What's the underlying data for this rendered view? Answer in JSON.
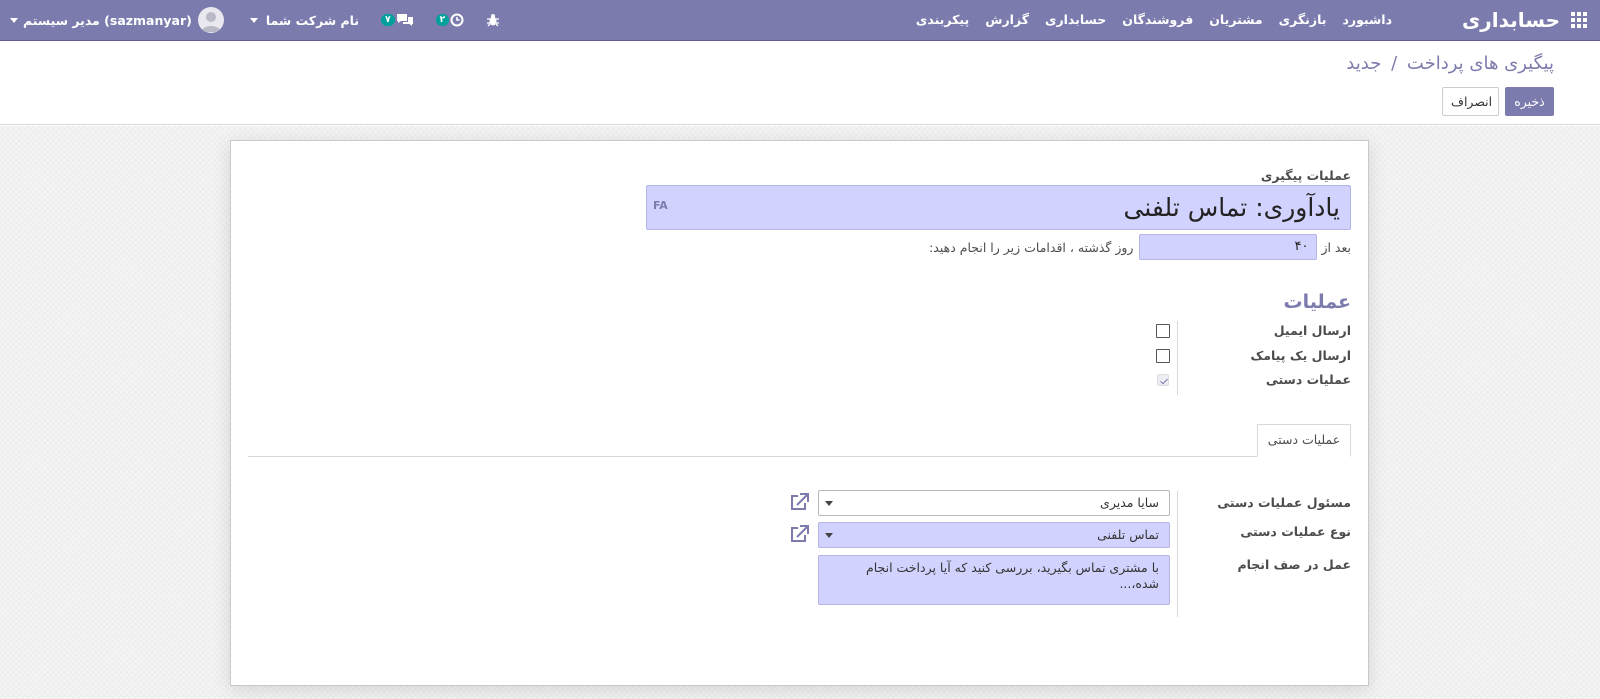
{
  "navbar": {
    "app_title": "حسابداری",
    "menu": [
      "داشبورد",
      "بازنگری",
      "مشتریان",
      "فروشندگان",
      "حسابداری",
      "گزارش",
      "پیکربندی"
    ],
    "user_label": "مدیر سیستم (sazmanyar)",
    "company_label": "نام شرکت شما",
    "messages_count": "۷",
    "activities_count": "۲"
  },
  "control_panel": {
    "breadcrumb_parent": "پیگیری های پرداخت",
    "breadcrumb_sep": "/",
    "breadcrumb_current": "جدید",
    "save_label": "ذخیره",
    "cancel_label": "انصراف"
  },
  "form": {
    "name_label": "عملیات پیگیری",
    "name_value": "یادآوری: تماس تلفنی",
    "lang_tag": "FA",
    "delay_prefix": "بعد از",
    "delay_value": "۴۰",
    "delay_suffix": "روز گذشته ، اقدامات زیر را انجام دهید:",
    "section_title": "عملیات",
    "options": [
      {
        "label": "ارسال ایمیل",
        "checked": false
      },
      {
        "label": "ارسال یک پیامک",
        "checked": false
      },
      {
        "label": "عملیات دستی",
        "checked": true
      }
    ],
    "tab_label": "عملیات دستی",
    "responsible_label": "مسئول عملیات دستی",
    "responsible_value": "سایا مدیری",
    "action_type_label": "نوع عملیات دستی",
    "action_type_value": "تماس تلفنی",
    "action_note_label": "عمل در صف انجام",
    "action_note_value": "با مشتری تماس بگیرید، بررسی کنید که آیا پرداخت انجام شده،..."
  },
  "colors": {
    "brand": "#7c7bad",
    "required_field": "#d2d2ff",
    "badge": "#00a09d"
  }
}
